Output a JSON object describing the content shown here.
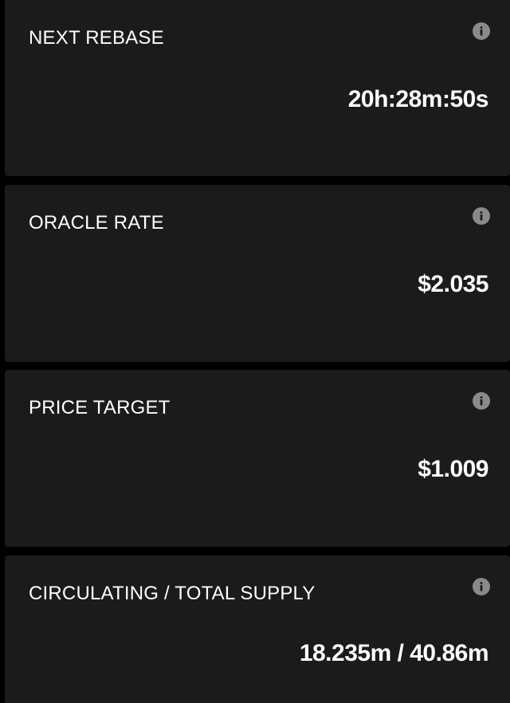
{
  "cards": [
    {
      "label": "NEXT REBASE",
      "value": "20h:28m:50s",
      "info_icon": "info-icon"
    },
    {
      "label": "ORACLE RATE",
      "value": "$2.035",
      "info_icon": "info-icon"
    },
    {
      "label": "PRICE TARGET",
      "value": "$1.009",
      "info_icon": "info-icon"
    },
    {
      "label": "CIRCULATING / TOTAL SUPPLY",
      "value": "18.235m / 40.86m",
      "info_icon": "info-icon"
    }
  ],
  "colors": {
    "background": "#000000",
    "card": "#1b1b1b",
    "text": "#ffffff",
    "icon": "#8a8a8a"
  }
}
